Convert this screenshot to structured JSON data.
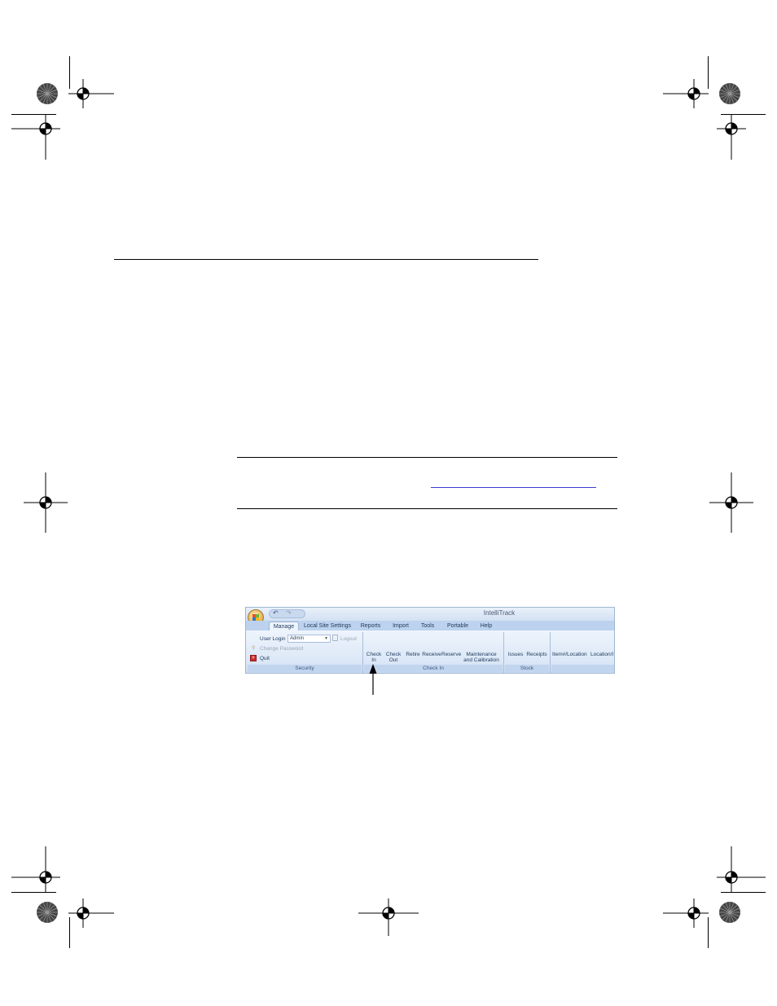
{
  "screenshot": {
    "app_title": "IntelliTrack",
    "tabs": [
      {
        "label": "Manage",
        "active": true
      },
      {
        "label": "Local Site Settings",
        "active": false
      },
      {
        "label": "Reports",
        "active": false
      },
      {
        "label": "Import",
        "active": false
      },
      {
        "label": "Tools",
        "active": false
      },
      {
        "label": "Portable",
        "active": false
      },
      {
        "label": "Help",
        "active": false
      }
    ],
    "security": {
      "user_login_label": "User Login",
      "user_login_value": "Admin",
      "logout_label": "Logout",
      "change_password_label": "Change Password",
      "quit_label": "Quit",
      "group_label": "Security"
    },
    "check_in": {
      "buttons": [
        {
          "line1": "Check",
          "line2": "In"
        },
        {
          "line1": "Check",
          "line2": "Out"
        },
        {
          "line1": "Retire",
          "line2": ""
        },
        {
          "line1": "Receive",
          "line2": ""
        },
        {
          "line1": "Reserve",
          "line2": ""
        },
        {
          "line1": "Maintenance",
          "line2": "and Calibration"
        }
      ],
      "group_label": "Check In"
    },
    "stock": {
      "buttons": [
        "Issues",
        "Receipts"
      ],
      "group_label": "Stock"
    },
    "next_group": {
      "buttons": [
        "Item#/Location",
        "Location/I"
      ]
    },
    "colors": {
      "ribbon_background": "#dbe7f6",
      "tab_bar": "#bcd2ee",
      "label_text": "#1e395b",
      "quit_icon": "#d0312d"
    },
    "icons": [
      "office-button-icon",
      "undo-icon",
      "redo-icon",
      "logout-icon",
      "key-icon",
      "quit-icon",
      "callout-arrow-icon"
    ]
  }
}
